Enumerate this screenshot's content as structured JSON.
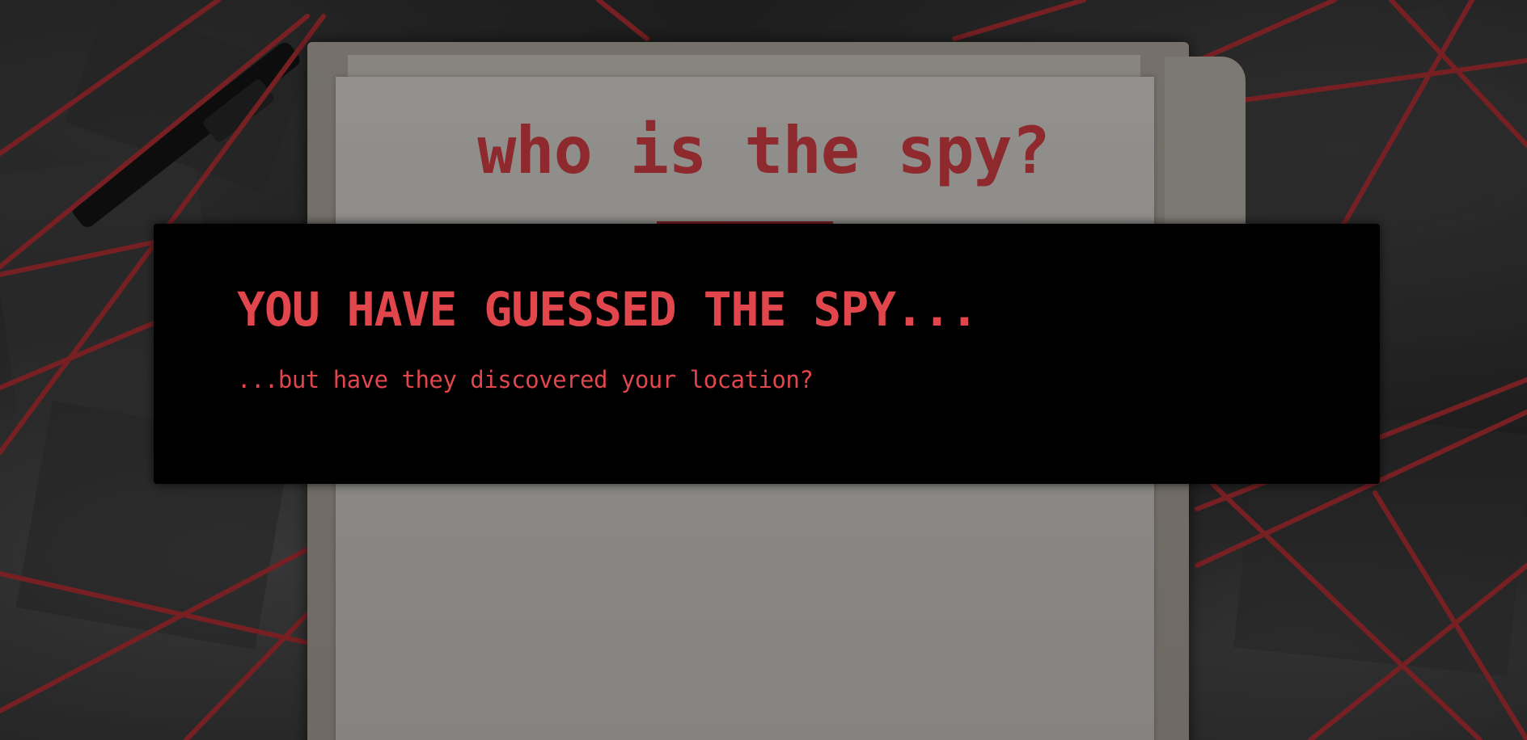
{
  "page": {
    "title": "who is the spy?"
  },
  "modal": {
    "heading": "YOU HAVE GUESSED THE SPY...",
    "subtext": "...but have they discovered your location?"
  },
  "colors": {
    "accent_red": "#e0464c",
    "title_red": "#8e2a2e",
    "string_red": "#c0343a",
    "modal_bg": "#000000"
  }
}
